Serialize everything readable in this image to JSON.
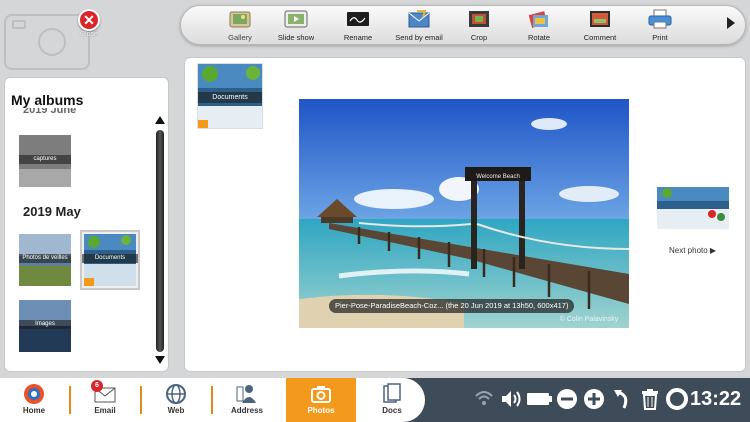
{
  "close": {
    "label": "Close"
  },
  "toolbar": {
    "tools": [
      {
        "label": "Gallery",
        "icon": "gallery-icon",
        "active": true
      },
      {
        "label": "Slide show",
        "icon": "slideshow-icon"
      },
      {
        "label": "Rename",
        "icon": "rename-icon"
      },
      {
        "label": "Send by email",
        "icon": "send-email-icon"
      },
      {
        "label": "Crop",
        "icon": "crop-icon"
      },
      {
        "label": "Rotate",
        "icon": "rotate-icon"
      },
      {
        "label": "Comment",
        "icon": "comment-icon"
      },
      {
        "label": "Print",
        "icon": "print-icon"
      }
    ],
    "next_icon": "chevron-right-icon"
  },
  "albums": {
    "title": "My albums",
    "clipped_year": "2019 June",
    "items": [
      {
        "caption": "captures"
      },
      {
        "year": "2019 May"
      },
      {
        "caption": "Photos de veilles"
      },
      {
        "caption": "Documents",
        "selected": true
      },
      {
        "caption": "Images"
      }
    ]
  },
  "viewer": {
    "current_thumb_caption": "Documents",
    "photo_caption": "Pier-Pose-ParadiseBeach-Coz... (the 20 Jun 2019 at 13h50, 600x417)",
    "watermark": "© Colin Palavinsky",
    "pier_sign": "Welcome Beach",
    "next_label": "Next photo ▶"
  },
  "bottom_nav": [
    {
      "label": "Home",
      "icon": "home-icon"
    },
    {
      "label": "Email",
      "icon": "email-icon",
      "badge": "6"
    },
    {
      "label": "Web",
      "icon": "web-icon"
    },
    {
      "label": "Address",
      "icon": "address-icon"
    },
    {
      "label": "Photos",
      "icon": "camera-icon",
      "active": true
    },
    {
      "label": "Docs",
      "icon": "docs-icon"
    }
  ],
  "status": {
    "time": "13:22",
    "icons": [
      "wifi-icon",
      "volume-icon",
      "battery-icon",
      "zoom-out-icon",
      "zoom-in-icon",
      "back-icon",
      "trash-icon",
      "help-icon"
    ]
  },
  "colors": {
    "accent_orange": "#f39a1d",
    "close_red": "#d9262b",
    "bottom_bar": "#3e4c5a"
  }
}
